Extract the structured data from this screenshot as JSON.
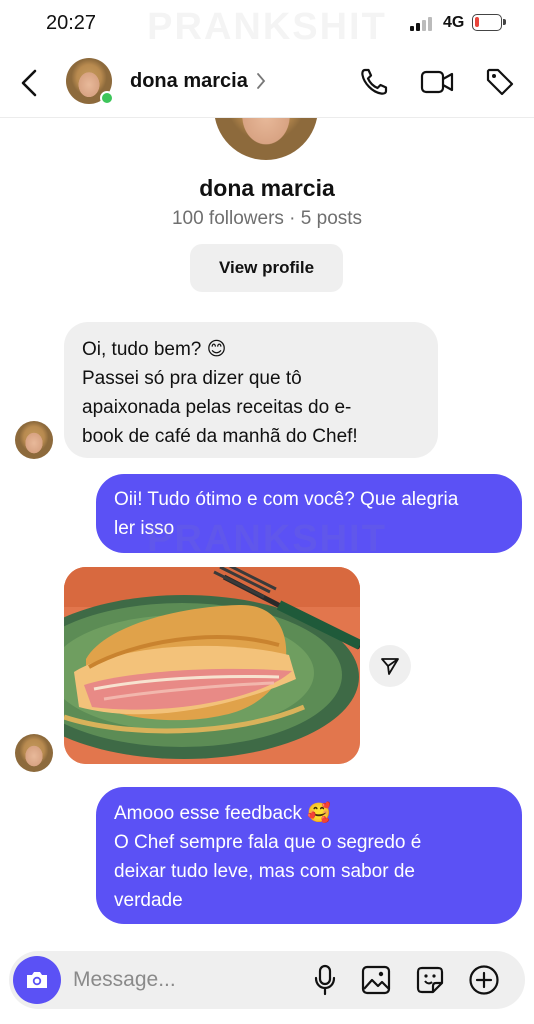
{
  "status_bar": {
    "time": "20:27",
    "network": "4G",
    "battery_level": 0.15
  },
  "watermark": "PRANKSHIT",
  "header": {
    "contact_name": "dona marcia"
  },
  "profile": {
    "name": "dona marcia",
    "meta": "100 followers · 5 posts",
    "view_profile_label": "View profile"
  },
  "messages": [
    {
      "direction": "incoming",
      "lines": [
        "Oi, tudo bem? 😊",
        "Passei só pra dizer que tô",
        "apaixonada pelas receitas do e-",
        "book de café da manhã do Chef!"
      ]
    },
    {
      "direction": "outgoing",
      "lines": [
        "Oii! Tudo ótimo e com você? Que alegria",
        "ler isso"
      ]
    },
    {
      "direction": "incoming",
      "type": "photo",
      "description_icon": "omelette-photo"
    },
    {
      "direction": "outgoing",
      "lines": [
        "Amooo esse feedback 🥰",
        "O Chef sempre fala que o segredo é",
        "deixar tudo leve, mas com sabor de",
        "verdade"
      ]
    }
  ],
  "composer": {
    "placeholder": "Message..."
  },
  "colors": {
    "accent": "#5b51f5",
    "incoming_bubble": "#efefef",
    "online": "#3dc55a"
  }
}
